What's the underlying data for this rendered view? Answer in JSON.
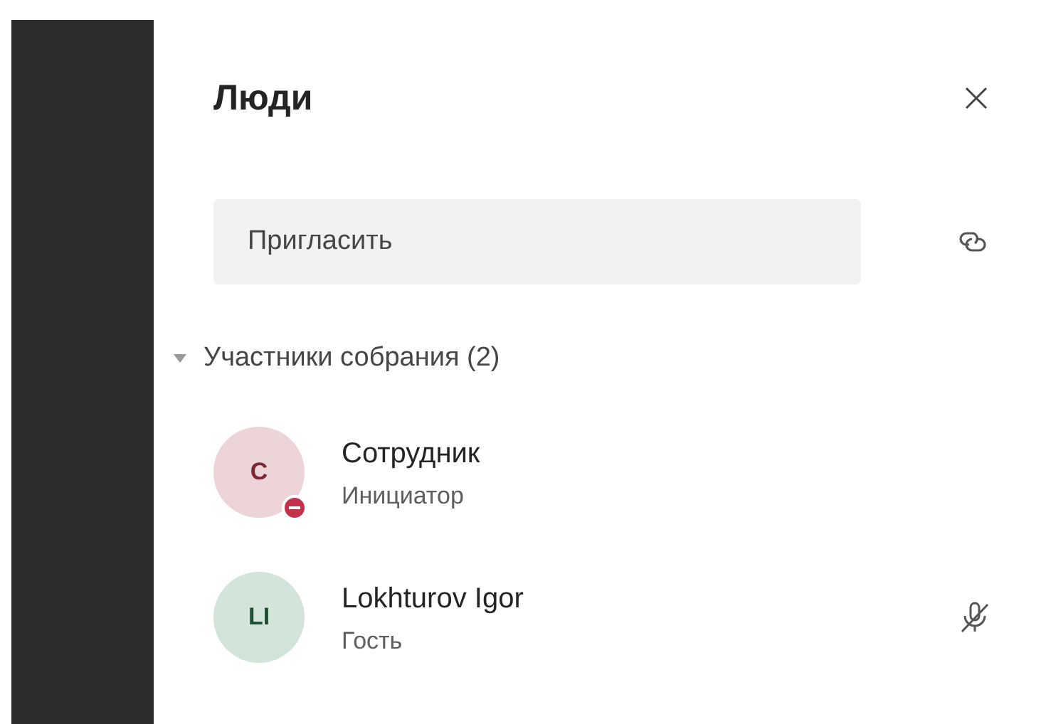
{
  "panel": {
    "title": "Люди"
  },
  "invite": {
    "placeholder": "Пригласить"
  },
  "section": {
    "label": "Участники собрания (2)",
    "expanded": true
  },
  "participants": [
    {
      "initials": "С",
      "name": "Сотрудник",
      "role": "Инициатор",
      "color": "#ecd4d8",
      "busy": true,
      "muted": false
    },
    {
      "initials": "LI",
      "name": "Lokhturov Igor",
      "role": "Гость",
      "color": "#d3e5da",
      "busy": false,
      "muted": true
    }
  ]
}
